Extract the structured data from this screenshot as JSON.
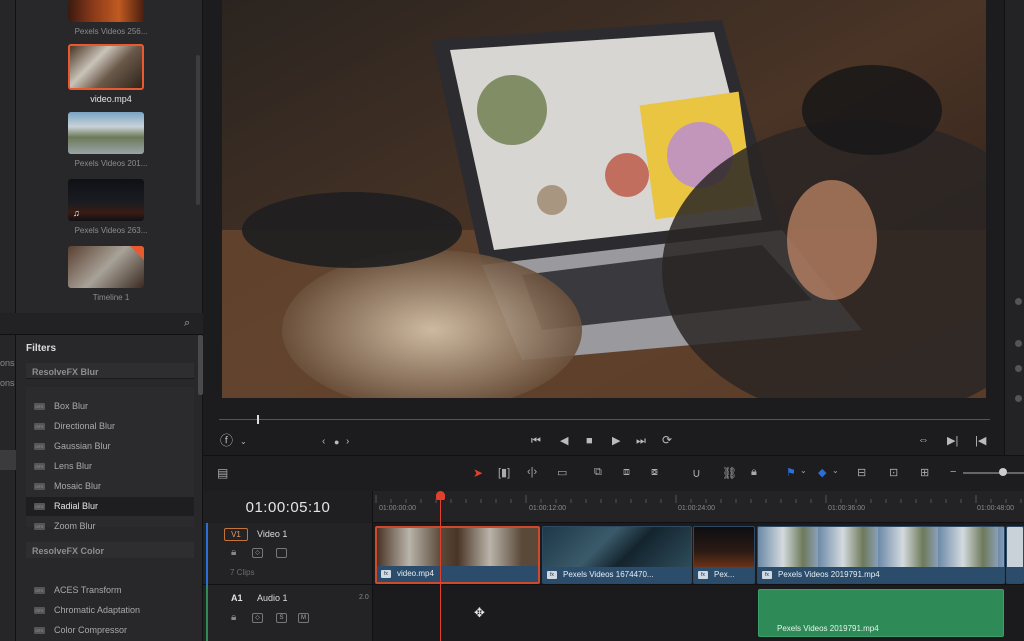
{
  "left_strip": {
    "labels": [
      "ons",
      "ons"
    ]
  },
  "media_pool": {
    "items": [
      {
        "label": "Pexels Videos 256...",
        "selected": false
      },
      {
        "label": "video.mp4",
        "selected": true
      },
      {
        "label": "Pexels Videos 201...",
        "selected": false
      },
      {
        "label": "Pexels Videos 263...",
        "selected": false,
        "icon": "music-note-icon"
      },
      {
        "label": "Timeline 1",
        "selected": false
      }
    ]
  },
  "effects": {
    "header": "Filters",
    "categories": [
      {
        "title": "ResolveFX Blur",
        "items": [
          "Box Blur",
          "Directional Blur",
          "Gaussian Blur",
          "Lens Blur",
          "Mosaic Blur",
          "Radial Blur",
          "Zoom Blur"
        ],
        "selected": "Radial Blur"
      },
      {
        "title": "ResolveFX Color",
        "items": [
          "ACES Transform",
          "Chromatic Adaptation",
          "Color Compressor"
        ]
      }
    ]
  },
  "viewer": {
    "timeline_name": "Timeline 1"
  },
  "timeline": {
    "timecode": "01:00:05:10",
    "ruler": [
      "01:00:00:00",
      "01:00:12:00",
      "01:00:24:00",
      "01:00:36:00",
      "01:00:48:00"
    ],
    "tracks": {
      "v1": {
        "id": "V1",
        "name": "Video 1",
        "clips_count": "7 Clips"
      },
      "a1": {
        "id": "A1",
        "name": "Audio 1",
        "channels": "2.0"
      }
    },
    "clips": [
      {
        "label": "video.mp4"
      },
      {
        "label": "Pexels Videos 1674470..."
      },
      {
        "label": "Pex..."
      },
      {
        "label": "Pexels Videos 2019791.mp4"
      }
    ],
    "audio_clip": {
      "label": "Pexels Videos 2019791.mp4"
    }
  },
  "colors": {
    "accent": "#e0402d",
    "video_clip": "#2b4d6b",
    "audio_clip": "#2e8a57",
    "flag_blue": "#2a6fd6"
  }
}
